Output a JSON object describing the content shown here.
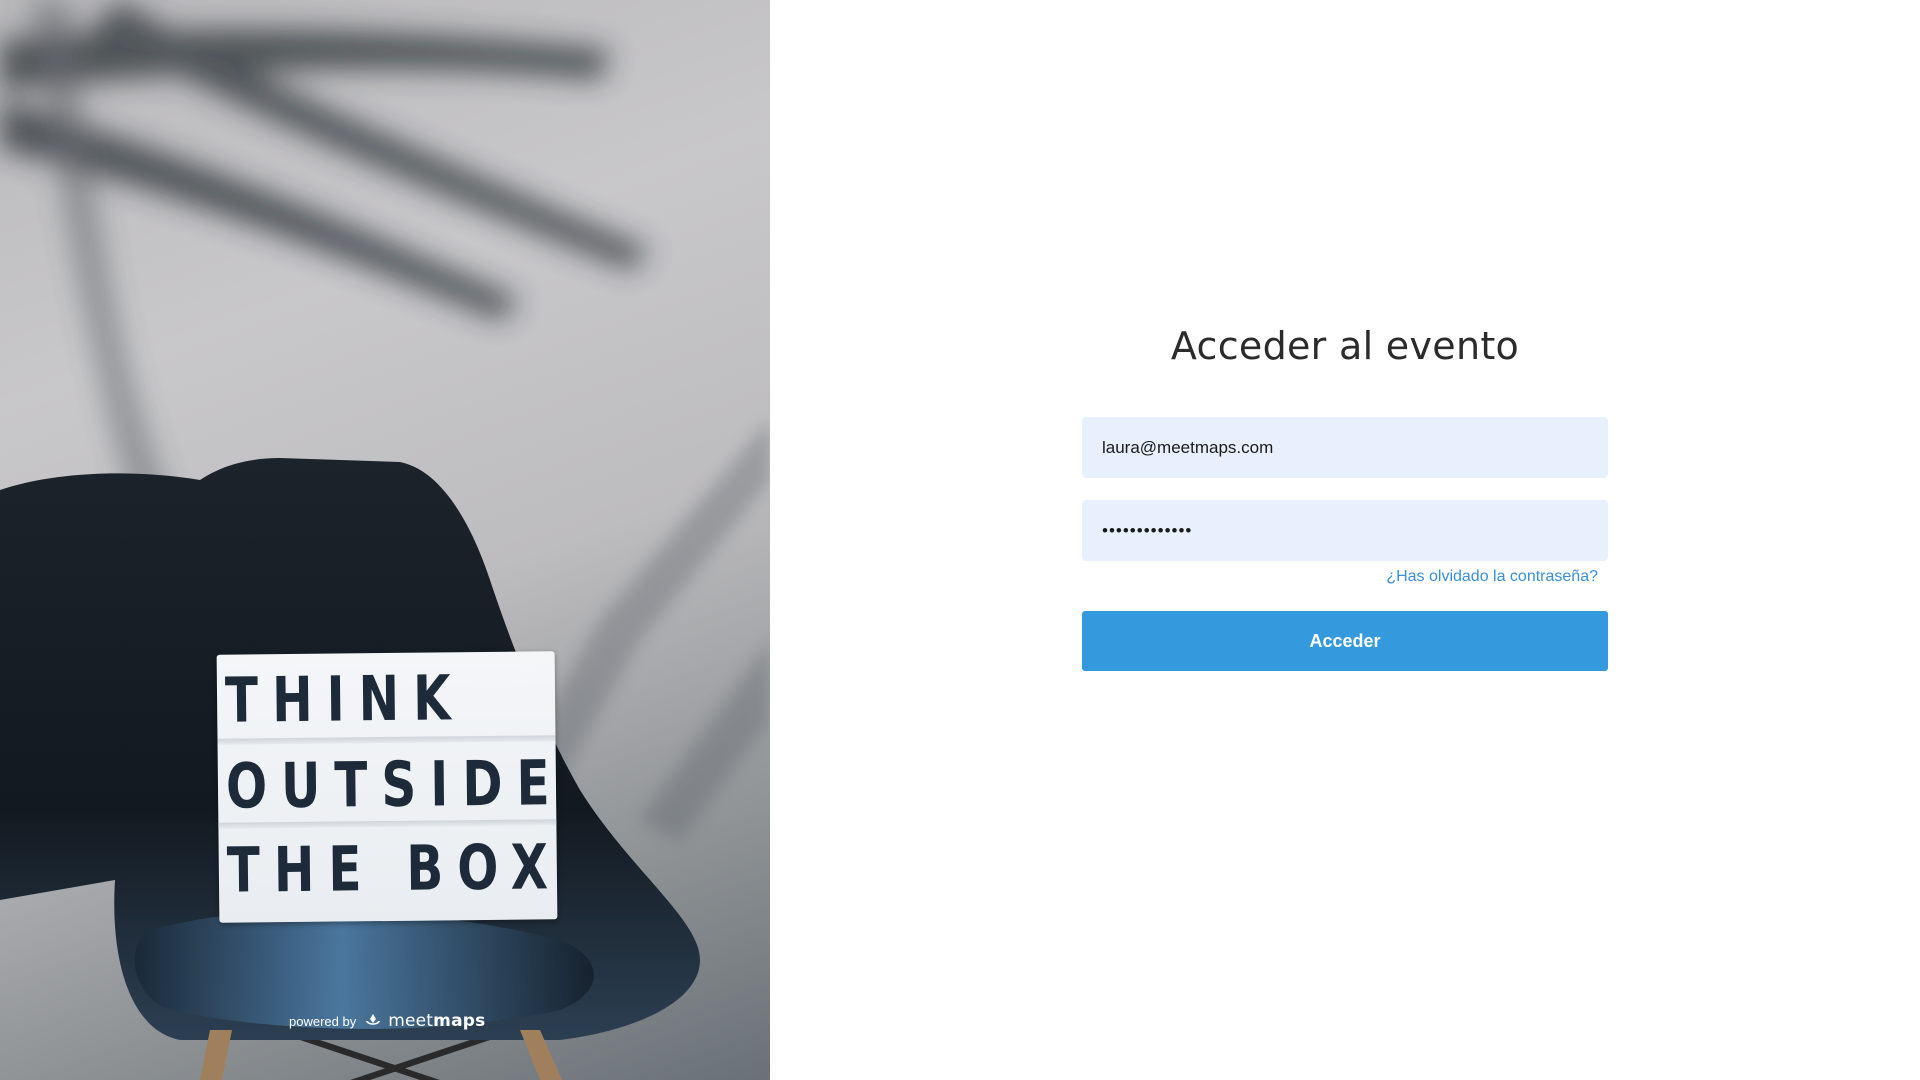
{
  "hero": {
    "sign_line1": "THINK",
    "sign_line2": "OUTSIDE",
    "sign_line3": "THE BOX",
    "powered_by": "powered by",
    "brand_light": "meet",
    "brand_bold": "maps",
    "brand_icon": "meetmaps-logo-icon"
  },
  "login": {
    "title": "Acceder al evento",
    "email_value": "laura@meetmaps.com",
    "password_value": "•••••••••••••",
    "forgot_label": "¿Has olvidado la contraseña?",
    "submit_label": "Acceder"
  },
  "colors": {
    "accent": "#3499dd",
    "link": "#3a8fd6",
    "input_bg": "#e8f0fe",
    "title": "#2b2b2b"
  }
}
